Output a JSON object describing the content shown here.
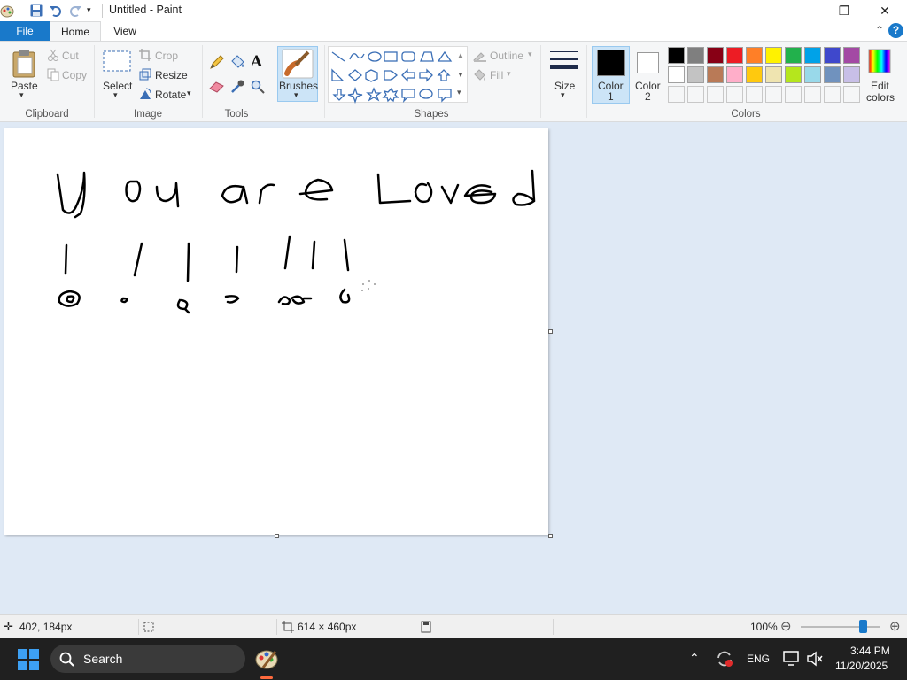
{
  "window": {
    "title": "Untitled - Paint",
    "controls": {
      "minimize": "—",
      "maximize": "❐",
      "close": "✕"
    }
  },
  "tabs": {
    "file": "File",
    "home": "Home",
    "view": "View"
  },
  "help": "?",
  "ribbon": {
    "clipboard": {
      "paste": "Paste",
      "cut": "Cut",
      "copy": "Copy",
      "label": "Clipboard"
    },
    "image": {
      "select": "Select",
      "crop": "Crop",
      "resize": "Resize",
      "rotate": "Rotate",
      "label": "Image"
    },
    "tools": {
      "label": "Tools"
    },
    "brushes": {
      "label": "Brushes"
    },
    "shapes": {
      "outline": "Outline",
      "fill": "Fill",
      "label": "Shapes"
    },
    "size": {
      "label": "Size"
    },
    "colors": {
      "color1": "Color",
      "color1_num": "1",
      "color2": "Color",
      "color2_num": "2",
      "edit": "Edit",
      "edit2": "colors",
      "label": "Colors",
      "palette_row1": [
        "#000000",
        "#7f7f7f",
        "#880015",
        "#ed1c24",
        "#ff7f27",
        "#fff200",
        "#22b14c",
        "#00a2e8",
        "#3f48cc",
        "#a349a4"
      ],
      "palette_row2": [
        "#ffffff",
        "#c3c3c3",
        "#b97a57",
        "#ffaec9",
        "#ffc90e",
        "#efe4b0",
        "#b5e61d",
        "#99d9ea",
        "#7092be",
        "#c8bfe7"
      ],
      "color1_value": "#000000",
      "color2_value": "#ffffff"
    }
  },
  "canvas_drawing": {
    "headline": "you are Loved",
    "row2_marks": "|  /  |  |  / / |",
    "row3_marks": "o  ,  e  o  oo  e"
  },
  "status": {
    "cursor_pos": "402, 184px",
    "canvas_size": "614 × 460px",
    "zoom": "100%",
    "zoom_level": 0.78
  },
  "taskbar": {
    "search": "Search",
    "language": "ENG",
    "time": "3:44 PM",
    "date": "11/20/2025"
  }
}
